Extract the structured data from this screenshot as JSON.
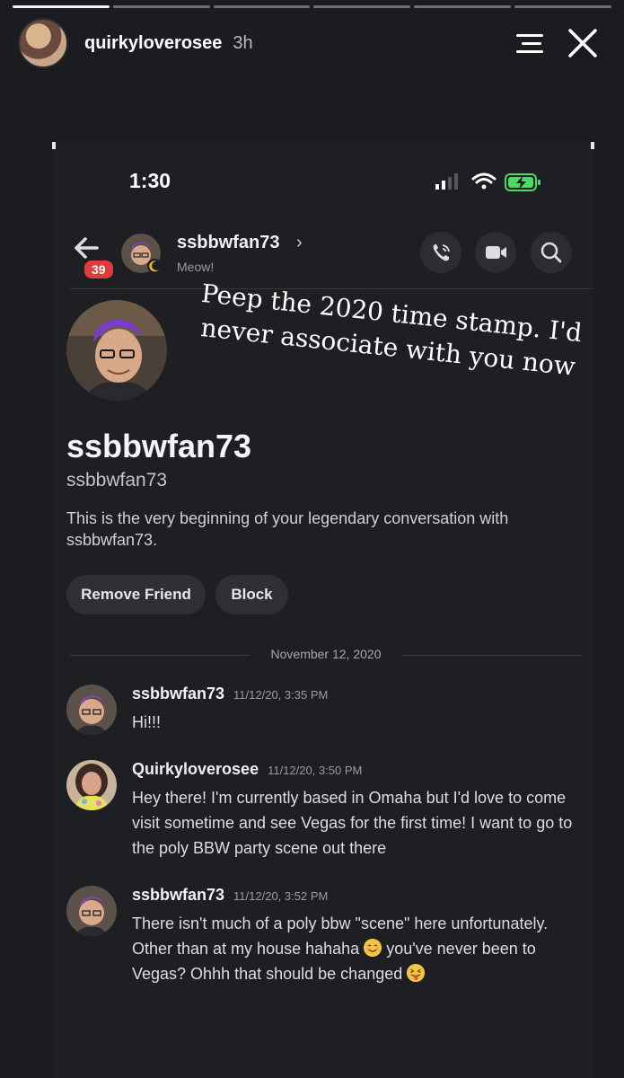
{
  "story": {
    "username": "quirkyloverosee",
    "age": "3h",
    "segments": 6,
    "segments_done": 1
  },
  "status_bar": {
    "time": "1:30"
  },
  "chat_header": {
    "badge_count": "39",
    "name": "ssbbwfan73",
    "chevron": "›",
    "status": "Meow!"
  },
  "overlay_note": "Peep the 2020 time stamp. I'd never associate with you now",
  "profile": {
    "display_name": "ssbbwfan73",
    "handle": "ssbbwfan73",
    "intro": "This is the very beginning of your legendary conversation with ssbbwfan73.",
    "remove_friend_label": "Remove Friend",
    "block_label": "Block"
  },
  "date_separator": "November 12, 2020",
  "messages": [
    {
      "author": "ssbbwfan73",
      "time": "11/12/20, 3:35 PM",
      "text": "Hi!!!"
    },
    {
      "author": "Quirkyloverosee",
      "time": "11/12/20, 3:50 PM",
      "text": "Hey there! I'm currently based in Omaha but I'd love to come visit sometime and see Vegas for the first time! I want to go to the poly BBW party scene out there"
    },
    {
      "author": "ssbbwfan73",
      "time": "11/12/20, 3:52 PM",
      "text_1": "There isn't much of a poly bbw \"scene\" here unfortunately. Other than at my house hahaha",
      "text_2": "you've never been to Vegas? Ohhh that should be changed"
    }
  ],
  "icons": [
    "back-arrow-icon",
    "call-icon",
    "video-icon",
    "search-icon",
    "menu-icon",
    "close-icon",
    "signal-icon",
    "wifi-icon",
    "battery-icon",
    "smile-emoji-icon",
    "tongue-emoji-icon"
  ]
}
